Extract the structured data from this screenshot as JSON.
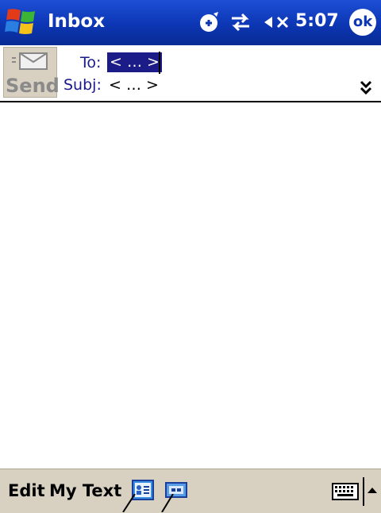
{
  "titlebar": {
    "title": "Inbox",
    "time": "5:07",
    "ok_label": "ok",
    "icons": [
      "windows-start-icon",
      "satellite-icon",
      "connectivity-icon",
      "speaker-muted-icon"
    ]
  },
  "header": {
    "send_label": "Send",
    "to_label": "To:",
    "to_value": "< … >",
    "subj_label": "Subj:",
    "subj_value": "< … >",
    "expand_icon": "double-chevron-down-icon"
  },
  "body": {
    "text": ""
  },
  "menubar": {
    "edit_label": "Edit",
    "mytext_label": "My Text",
    "icons": [
      "contact-card-icon",
      "insert-icon",
      "keyboard-icon",
      "up-arrow-icon"
    ]
  },
  "colors": {
    "titlebar": "#0c36b3",
    "menubar": "#d8d0c0",
    "selection": "#1c1c88",
    "label": "#1a1a8a"
  }
}
